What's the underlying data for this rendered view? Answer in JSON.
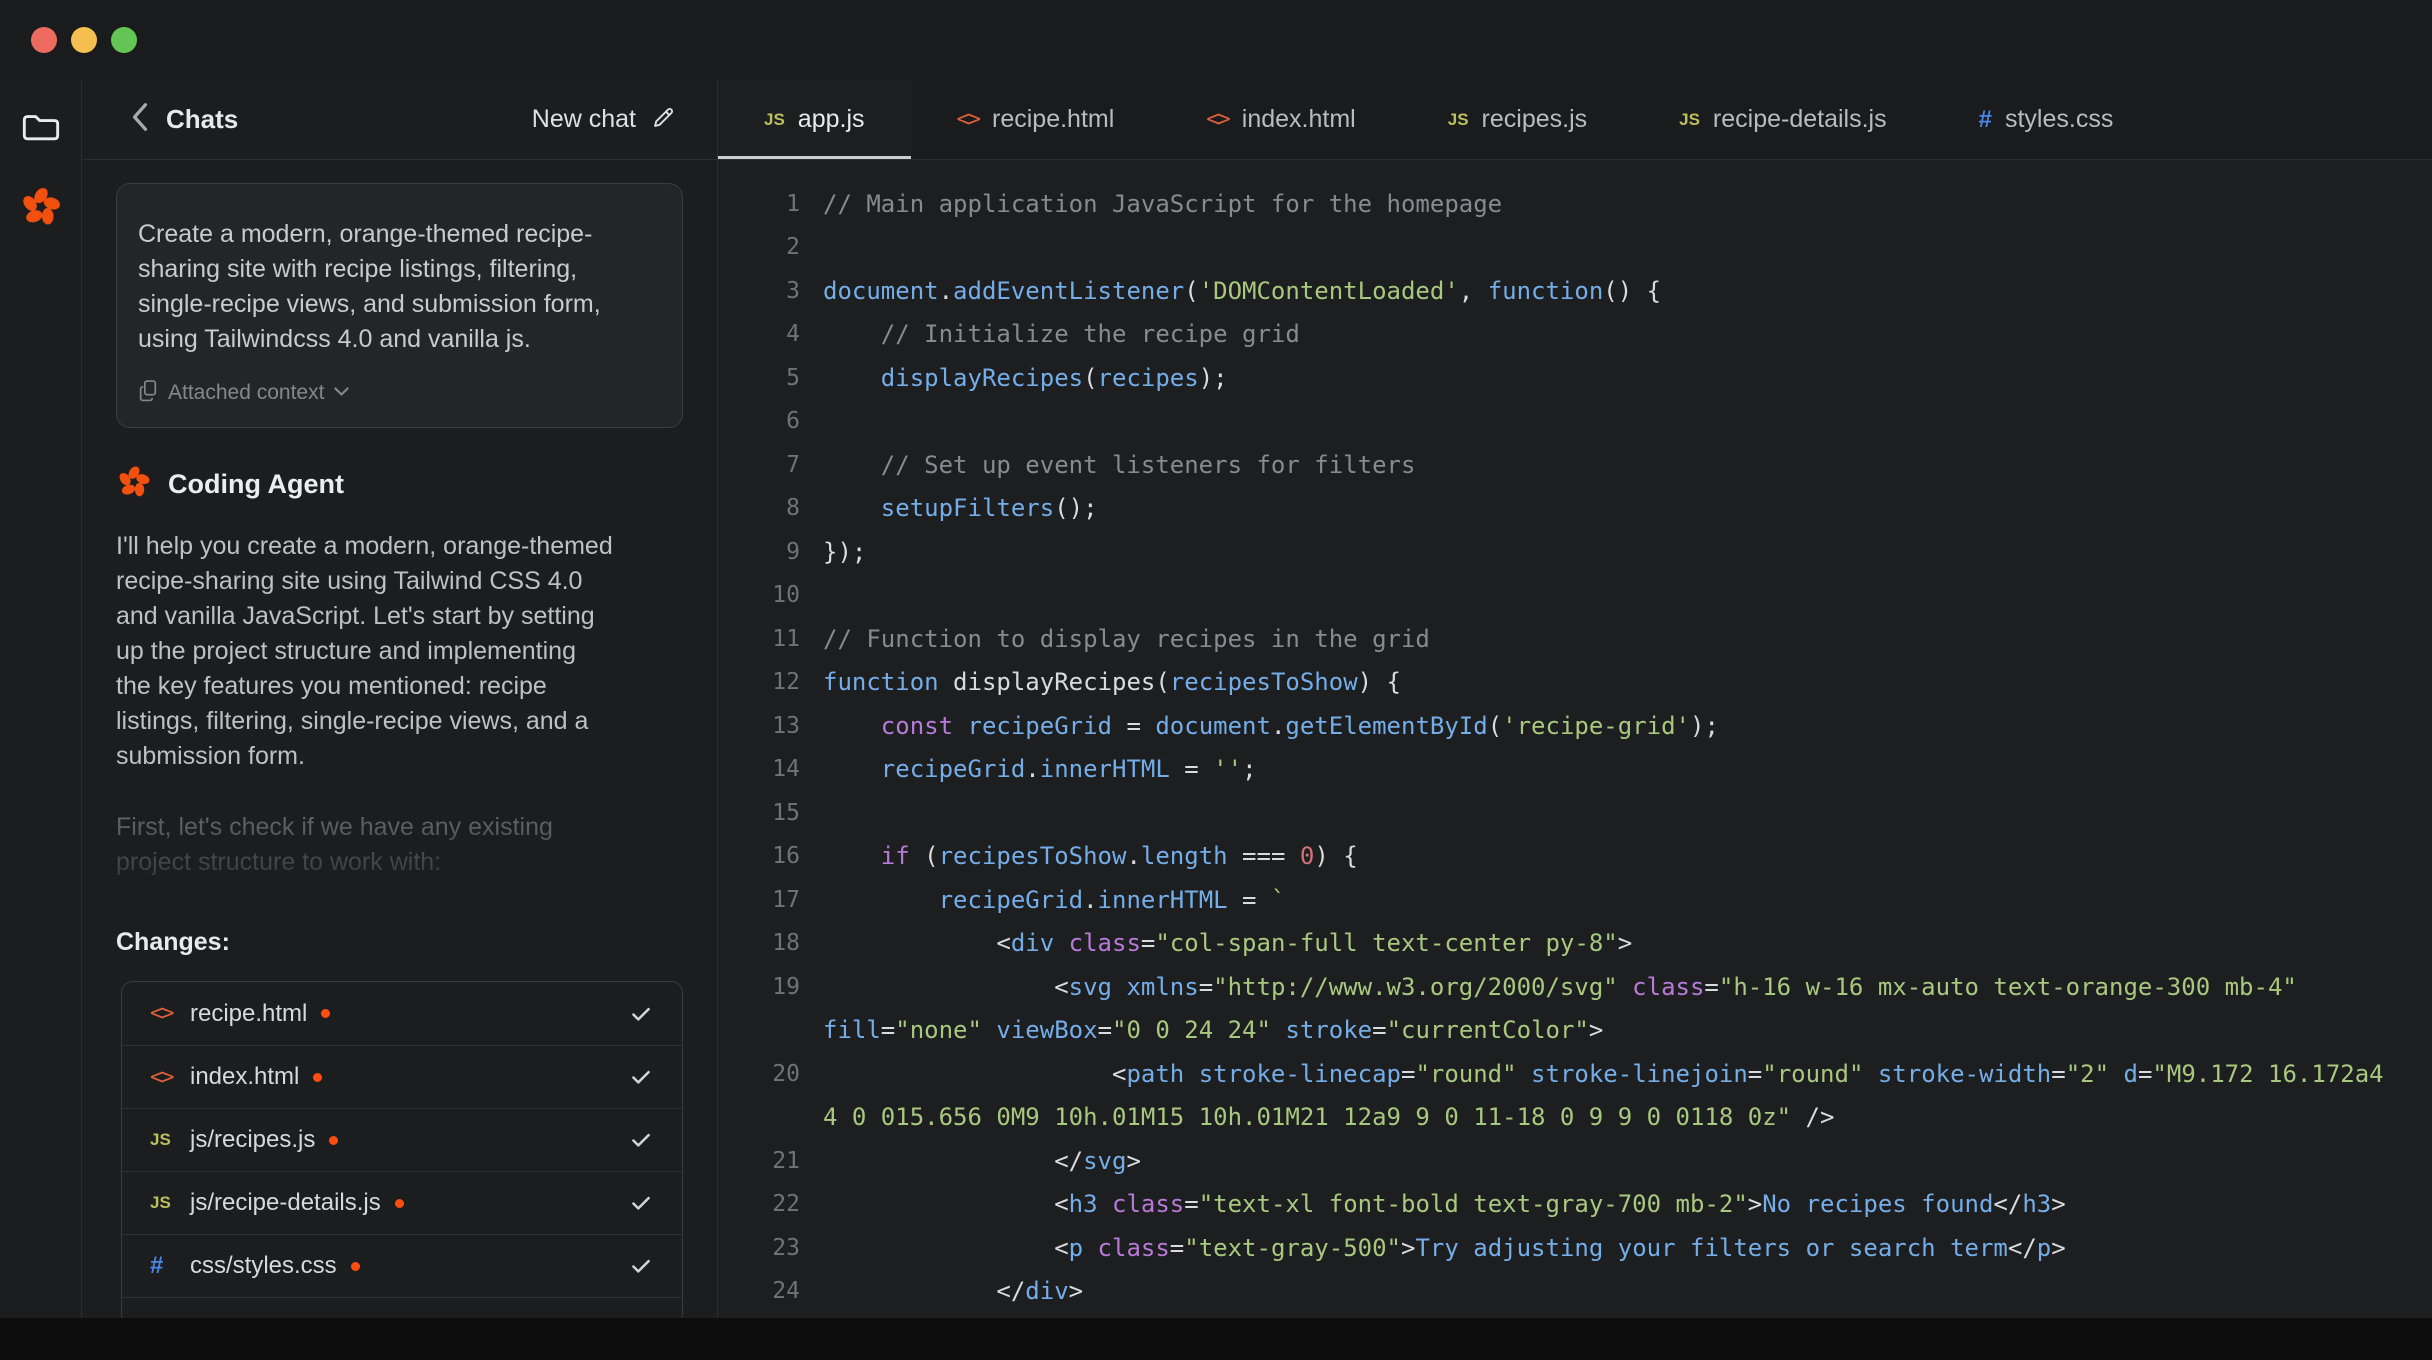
{
  "colors": {
    "accent_orange": "#f2500f",
    "dot_orange": "#ff4d10",
    "traffic_red": "#ec6a5e",
    "traffic_yellow": "#f5bf4f",
    "traffic_green": "#62c554",
    "js_icon": "#bdbe5d",
    "html_icon": "#e0603c",
    "css_icon": "#4a86e8",
    "active_tab_underline": "#cbcdd1"
  },
  "chat": {
    "header": {
      "back_label": "Chats",
      "new_chat_label": "New chat"
    },
    "user_message": {
      "text": "Create a modern, orange-themed recipe-\nsharing site with recipe listings, filtering,\nsingle-recipe views, and submission form,\nusing Tailwindcss 4.0 and vanilla js.",
      "attached_context_label": "Attached context"
    },
    "agent": {
      "name": "Coding Agent",
      "response": "I'll help you create a modern, orange-themed\nrecipe-sharing site using Tailwind CSS 4.0\nand vanilla JavaScript. Let's start by setting\nup the project structure and implementing\nthe key features you mentioned: recipe\nlistings, filtering, single-recipe views, and a\nsubmission form.",
      "faded_text": "First, let's check if we have any existing\nproject structure to work with:"
    },
    "changes": {
      "label": "Changes:",
      "files": [
        {
          "name": "recipe.html",
          "type": "html",
          "modified": true,
          "checked": true
        },
        {
          "name": "index.html",
          "type": "html",
          "modified": true,
          "checked": true
        },
        {
          "name": "js/recipes.js",
          "type": "js",
          "modified": true,
          "checked": true
        },
        {
          "name": "js/recipe-details.js",
          "type": "js",
          "modified": true,
          "checked": true
        },
        {
          "name": "css/styles.css",
          "type": "css",
          "modified": true,
          "checked": true
        }
      ]
    }
  },
  "editor": {
    "tabs": [
      {
        "label": "app.js",
        "type": "js",
        "active": true
      },
      {
        "label": "recipe.html",
        "type": "html",
        "active": false
      },
      {
        "label": "index.html",
        "type": "html",
        "active": false
      },
      {
        "label": "recipes.js",
        "type": "js",
        "active": false
      },
      {
        "label": "recipe-details.js",
        "type": "js",
        "active": false
      },
      {
        "label": "styles.css",
        "type": "css",
        "active": false
      }
    ],
    "code_rows": [
      {
        "n": "1",
        "t": [
          [
            "c",
            "// Main application JavaScript for the homepage"
          ]
        ]
      },
      {
        "n": "2",
        "t": []
      },
      {
        "n": "3",
        "t": [
          [
            "b",
            "document"
          ],
          [
            "w",
            "."
          ],
          [
            "b",
            "addEventListener"
          ],
          [
            "w",
            "("
          ],
          [
            "g",
            "'DOMContentLoaded'"
          ],
          [
            "w",
            ", "
          ],
          [
            "b",
            "function"
          ],
          [
            "w",
            "() {"
          ]
        ]
      },
      {
        "n": "4",
        "t": [
          [
            "w",
            "    "
          ],
          [
            "c",
            "// Initialize the recipe grid"
          ]
        ]
      },
      {
        "n": "5",
        "t": [
          [
            "w",
            "    "
          ],
          [
            "b",
            "displayRecipes"
          ],
          [
            "w",
            "("
          ],
          [
            "b",
            "recipes"
          ],
          [
            "w",
            ");"
          ]
        ]
      },
      {
        "n": "6",
        "t": []
      },
      {
        "n": "7",
        "t": [
          [
            "w",
            "    "
          ],
          [
            "c",
            "// Set up event listeners for filters"
          ]
        ]
      },
      {
        "n": "8",
        "t": [
          [
            "w",
            "    "
          ],
          [
            "b",
            "setupFilters"
          ],
          [
            "w",
            "();"
          ]
        ]
      },
      {
        "n": "9",
        "t": [
          [
            "w",
            "});"
          ]
        ]
      },
      {
        "n": "10",
        "t": []
      },
      {
        "n": "11",
        "t": [
          [
            "c",
            "// Function to display recipes in the grid"
          ]
        ]
      },
      {
        "n": "12",
        "t": [
          [
            "b",
            "function "
          ],
          [
            "w",
            "displayRecipes("
          ],
          [
            "b",
            "recipesToShow"
          ],
          [
            "w",
            ") {"
          ]
        ]
      },
      {
        "n": "13",
        "t": [
          [
            "w",
            "    "
          ],
          [
            "p",
            "const "
          ],
          [
            "b",
            "recipeGrid"
          ],
          [
            "w",
            " = "
          ],
          [
            "b",
            "document"
          ],
          [
            "w",
            "."
          ],
          [
            "b",
            "getElementById"
          ],
          [
            "w",
            "("
          ],
          [
            "g",
            "'recipe-grid'"
          ],
          [
            "w",
            ");"
          ]
        ]
      },
      {
        "n": "14",
        "t": [
          [
            "w",
            "    "
          ],
          [
            "b",
            "recipeGrid"
          ],
          [
            "w",
            "."
          ],
          [
            "b",
            "innerHTML"
          ],
          [
            "w",
            " = "
          ],
          [
            "g",
            "''"
          ],
          [
            "w",
            ";"
          ]
        ]
      },
      {
        "n": "15",
        "t": []
      },
      {
        "n": "16",
        "t": [
          [
            "w",
            "    "
          ],
          [
            "p",
            "if "
          ],
          [
            "w",
            "("
          ],
          [
            "b",
            "recipesToShow"
          ],
          [
            "w",
            "."
          ],
          [
            "b",
            "length"
          ],
          [
            "w",
            " === "
          ],
          [
            "r",
            "0"
          ],
          [
            "w",
            ") {"
          ]
        ]
      },
      {
        "n": "17",
        "t": [
          [
            "w",
            "        "
          ],
          [
            "b",
            "recipeGrid"
          ],
          [
            "w",
            "."
          ],
          [
            "b",
            "innerHTML"
          ],
          [
            "w",
            " = "
          ],
          [
            "g",
            "`"
          ]
        ]
      },
      {
        "n": "18",
        "t": [
          [
            "w",
            "            <"
          ],
          [
            "b",
            "div "
          ],
          [
            "p",
            "class"
          ],
          [
            "w",
            "="
          ],
          [
            "g",
            "\"col-span-full text-center py-8\""
          ],
          [
            "w",
            ">"
          ]
        ]
      },
      {
        "n": "19",
        "t": [
          [
            "w",
            "                <"
          ],
          [
            "b",
            "svg "
          ],
          [
            "b",
            "xmlns"
          ],
          [
            "w",
            "="
          ],
          [
            "g",
            "\"http://www.w3.org/2000/svg\""
          ],
          [
            "w",
            " "
          ],
          [
            "p",
            "class"
          ],
          [
            "w",
            "="
          ],
          [
            "g",
            "\"h-16 w-16 mx-auto text-orange-300 mb-4\""
          ]
        ]
      },
      {
        "n": "",
        "t": [
          [
            "b",
            "fill"
          ],
          [
            "w",
            "="
          ],
          [
            "g",
            "\"none\""
          ],
          [
            "w",
            " "
          ],
          [
            "b",
            "viewBox"
          ],
          [
            "w",
            "="
          ],
          [
            "g",
            "\"0 0 24 24\""
          ],
          [
            "w",
            " "
          ],
          [
            "b",
            "stroke"
          ],
          [
            "w",
            "="
          ],
          [
            "g",
            "\"currentColor\""
          ],
          [
            "w",
            ">"
          ]
        ]
      },
      {
        "n": "20",
        "t": [
          [
            "w",
            "                    <"
          ],
          [
            "b",
            "path "
          ],
          [
            "b",
            "stroke-linecap"
          ],
          [
            "w",
            "="
          ],
          [
            "g",
            "\"round\""
          ],
          [
            "w",
            " "
          ],
          [
            "b",
            "stroke-linejoin"
          ],
          [
            "w",
            "="
          ],
          [
            "g",
            "\"round\""
          ],
          [
            "w",
            " "
          ],
          [
            "b",
            "stroke-width"
          ],
          [
            "w",
            "="
          ],
          [
            "g",
            "\"2\""
          ],
          [
            "w",
            " "
          ],
          [
            "b",
            "d"
          ],
          [
            "w",
            "="
          ],
          [
            "g",
            "\"M9.172 16.172a4"
          ]
        ]
      },
      {
        "n": "",
        "t": [
          [
            "g",
            "4 0 015.656 0M9 10h.01M15 10h.01M21 12a9 9 0 11-18 0 9 9 0 0118 0z\""
          ],
          [
            "w",
            " />"
          ]
        ]
      },
      {
        "n": "21",
        "t": [
          [
            "w",
            "                </"
          ],
          [
            "b",
            "svg"
          ],
          [
            "w",
            ">"
          ]
        ]
      },
      {
        "n": "22",
        "t": [
          [
            "w",
            "                <"
          ],
          [
            "b",
            "h3 "
          ],
          [
            "p",
            "class"
          ],
          [
            "w",
            "="
          ],
          [
            "g",
            "\"text-xl font-bold text-gray-700 mb-2\""
          ],
          [
            "w",
            ">"
          ],
          [
            "b",
            "No recipes found"
          ],
          [
            "w",
            "</"
          ],
          [
            "b",
            "h3"
          ],
          [
            "w",
            ">"
          ]
        ]
      },
      {
        "n": "23",
        "t": [
          [
            "w",
            "                <"
          ],
          [
            "b",
            "p "
          ],
          [
            "p",
            "class"
          ],
          [
            "w",
            "="
          ],
          [
            "g",
            "\"text-gray-500\""
          ],
          [
            "w",
            ">"
          ],
          [
            "b",
            "Try adjusting your filters or search term"
          ],
          [
            "w",
            "</"
          ],
          [
            "b",
            "p"
          ],
          [
            "w",
            ">"
          ]
        ]
      },
      {
        "n": "24",
        "t": [
          [
            "w",
            "            </"
          ],
          [
            "b",
            "div"
          ],
          [
            "w",
            ">"
          ]
        ]
      }
    ]
  }
}
